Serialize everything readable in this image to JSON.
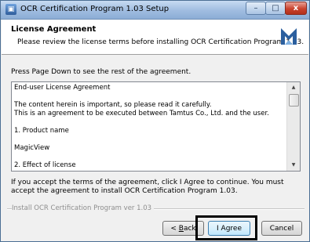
{
  "window": {
    "title": "OCR Certification Program 1.03 Setup",
    "minimize_glyph": "–",
    "maximize_glyph": "□",
    "close_glyph": "x"
  },
  "header": {
    "title": "License Agreement",
    "subtitle": "Please review the license terms before installing OCR Certification Program 1.03."
  },
  "instruction": "Press Page Down to see the rest of the agreement.",
  "license": {
    "lines": [
      "End-user License Agreement",
      "",
      "The content herein is important, so please read it carefully.",
      "This is an agreement to be executed between Tamtus Co., Ltd. and the user.",
      "",
      "1. Product name",
      "",
      "MagicView",
      "",
      "2. Effect of license"
    ]
  },
  "accept_text": "If you accept the terms of the agreement, click I Agree to continue. You must accept the agreement to install OCR Certification Program 1.03.",
  "footer_label": "Install OCR Certification Program ver 1.03",
  "buttons": {
    "back": "< Back",
    "agree": "I Agree",
    "cancel": "Cancel"
  },
  "colors": {
    "titlebar": "#9fbce0",
    "close_button": "#c9422d",
    "highlight": "#000000"
  },
  "icons": {
    "app": "installer-icon",
    "logo": "brand-logo-icon"
  }
}
